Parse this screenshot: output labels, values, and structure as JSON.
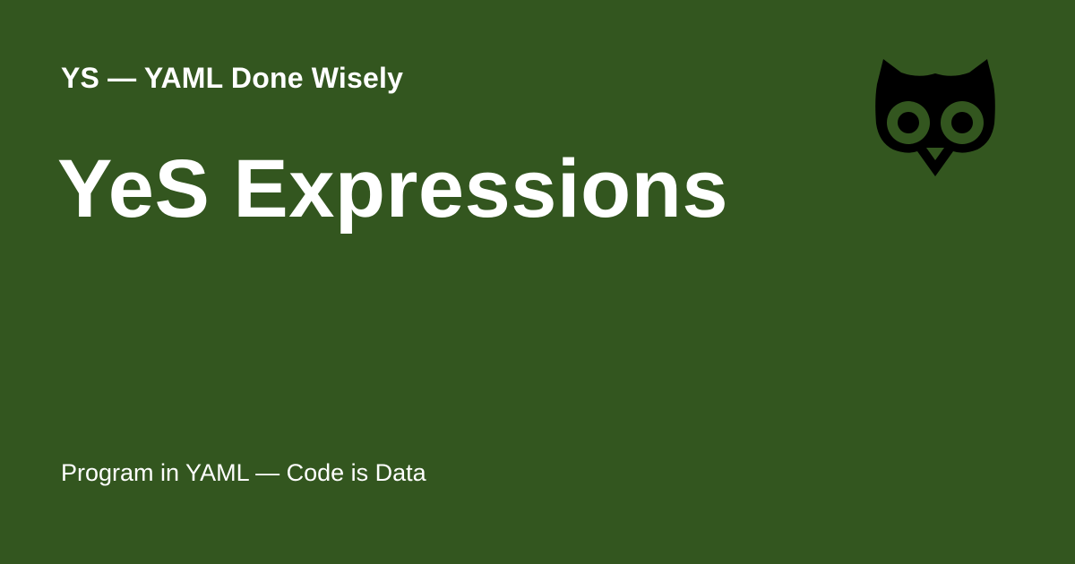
{
  "header": {
    "site_name": "YS — YAML Done Wisely"
  },
  "main": {
    "title": "YeS Expressions"
  },
  "footer": {
    "tagline": "Program in YAML — Code is Data"
  },
  "logo": {
    "icon": "owl-icon"
  },
  "colors": {
    "background": "#33561f",
    "text": "#ffffff",
    "logo": "#000000"
  }
}
